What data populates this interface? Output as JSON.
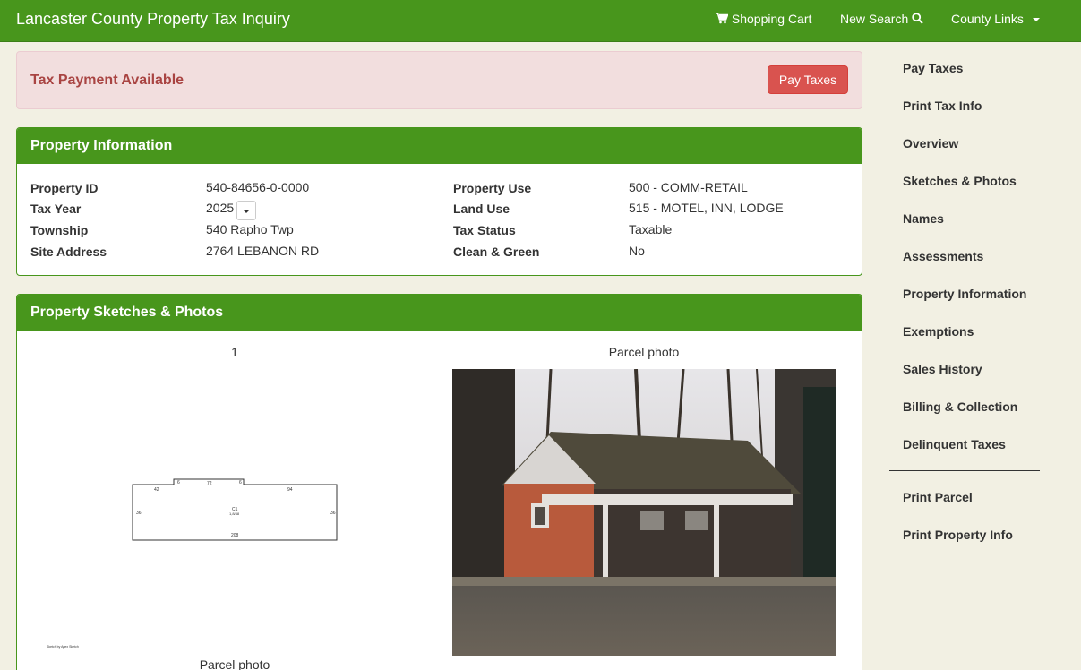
{
  "navbar": {
    "brand": "Lancaster County Property Tax Inquiry",
    "cart_label": "Shopping Cart",
    "search_label": "New Search",
    "links_label": "County Links"
  },
  "alert": {
    "title": "Tax Payment Available",
    "button_label": "Pay Taxes"
  },
  "info_panel": {
    "heading": "Property Information",
    "left": {
      "property_id_label": "Property ID",
      "property_id": "540-84656-0-0000",
      "tax_year_label": "Tax Year",
      "tax_year": "2025",
      "township_label": "Township",
      "township": "540 Rapho Twp",
      "site_address_label": "Site Address",
      "site_address": "2764 LEBANON RD"
    },
    "right": {
      "property_use_label": "Property Use",
      "property_use": "500 - COMM-RETAIL",
      "land_use_label": "Land Use",
      "land_use": "515 - MOTEL, INN, LODGE",
      "tax_status_label": "Tax Status",
      "tax_status": "Taxable",
      "clean_green_label": "Clean & Green",
      "clean_green": "No"
    }
  },
  "photos_panel": {
    "heading": "Property Sketches & Photos",
    "sketch_caption": "1",
    "photo_caption": "Parcel photo",
    "sketch_bottom_caption": "Parcel photo",
    "sketch_dims": {
      "top_left": "42",
      "notch_left": "6",
      "notch_top": "72",
      "notch_right": "6",
      "top_right": "94",
      "left": "36",
      "right": "36",
      "bottom": "208",
      "center_label": "C1",
      "center_area": "1,8/48"
    },
    "sketch_credit": "Sketch by Apex Sketch"
  },
  "sidebar": {
    "items": [
      "Pay Taxes",
      "Print Tax Info",
      "Overview",
      "Sketches & Photos",
      "Names",
      "Assessments",
      "Property Information",
      "Exemptions",
      "Sales History",
      "Billing & Collection",
      "Delinquent Taxes"
    ],
    "print_items": [
      "Print Parcel",
      "Print Property Info"
    ]
  },
  "colors": {
    "brand_green": "#48961c",
    "alert_bg": "#f2dede",
    "alert_text": "#a94442",
    "danger_button": "#d9534f",
    "page_bg": "#f2f0e3"
  },
  "icons": {
    "cart": "shopping-cart-icon",
    "search": "search-icon",
    "dropdown": "caret-down-icon"
  }
}
